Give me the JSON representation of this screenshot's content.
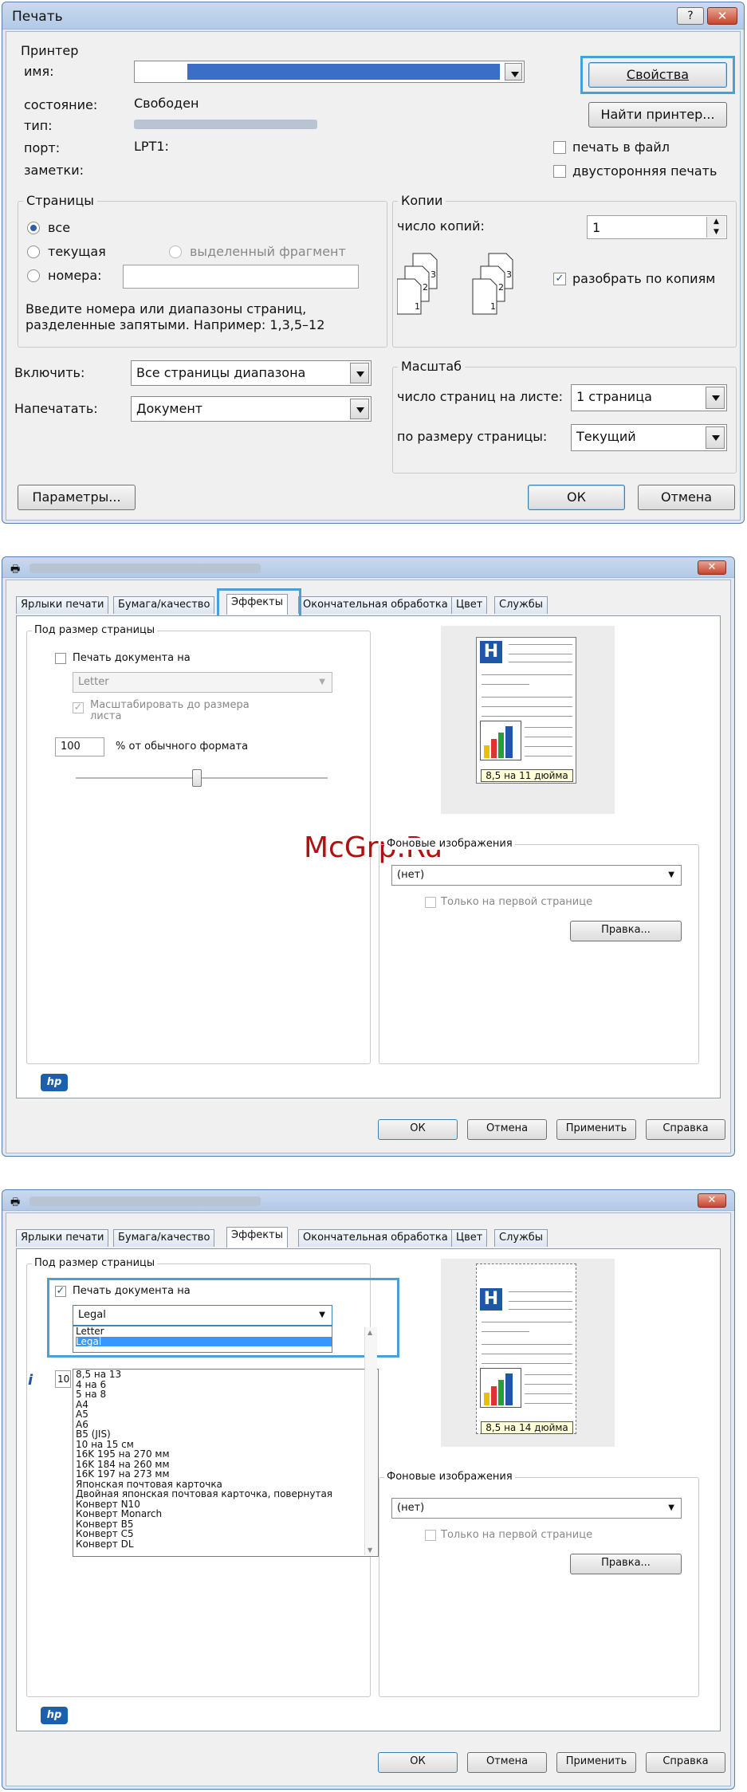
{
  "print_dialog": {
    "title": "Печать",
    "help_btn": "?",
    "printer_group": "Принтер",
    "name_label": "имя:",
    "status_label": "состояние:",
    "status_value": "Свободен",
    "type_label": "тип:",
    "port_label": "порт:",
    "port_value": "LPT1:",
    "comments_label": "заметки:",
    "properties_btn": "Свойства",
    "find_printer_btn": "Найти принтер...",
    "print_to_file": "печать в файл",
    "duplex": "двусторонняя печать",
    "pages_group": "Страницы",
    "all": "все",
    "current": "текущая",
    "selection": "выделенный фрагмент",
    "numbers": "номера:",
    "hint_line1": "Введите номера или диапазоны страниц,",
    "hint_line2": "разделенные запятыми. Например: 1,3,5–12",
    "copies_group": "Копии",
    "copies_label": "число копий:",
    "copies_value": "1",
    "collate": "разобрать по копиям",
    "include_label": "Включить:",
    "include_value": "Все страницы диапазона",
    "print_label": "Напечатать:",
    "print_value": "Документ",
    "scale_group": "Масштаб",
    "pages_per_sheet_label": "число страниц на листе:",
    "pages_per_sheet_value": "1 страница",
    "fit_label": "по размеру страницы:",
    "fit_value": "Текущий",
    "options_btn": "Параметры...",
    "ok_btn": "ОК",
    "cancel_btn": "Отмена"
  },
  "props1": {
    "tabs": [
      "Ярлыки печати",
      "Бумага/качество",
      "Эффекты",
      "Окончательная обработка",
      "Цвет",
      "Службы"
    ],
    "resize_group": "Под размер страницы",
    "print_doc_on": "Печать документа на",
    "paper_value": "Letter",
    "scale_to_fit_1": "Масштабировать до размера",
    "scale_to_fit_2": "листа",
    "percent_value": "100",
    "percent_label": "% от обычного формата",
    "preview_label": "8,5 на 11 дюйма",
    "watermarks_group": "Фоновые изображения",
    "watermark_value": "(нет)",
    "first_page_only": "Только на первой странице",
    "edit_btn": "Правка...",
    "ok_btn": "ОК",
    "cancel_btn": "Отмена",
    "apply_btn": "Применить",
    "help_btn": "Справка",
    "hp_logo": "hp"
  },
  "watermark_text": "McGrp.Ru",
  "props2": {
    "tabs": [
      "Ярлыки печати",
      "Бумага/качество",
      "Эффекты",
      "Окончательная обработка",
      "Цвет",
      "Службы"
    ],
    "resize_group": "Под размер страницы",
    "print_doc_on": "Печать документа на",
    "paper_value": "Legal",
    "top_list": [
      "Letter",
      "Legal"
    ],
    "list_items": [
      "8,5 на 13",
      "4 на 6",
      "5 на 8",
      "A4",
      "A5",
      "A6",
      "B5 (JIS)",
      "10 на 15 см",
      "16K 195 на 270 мм",
      "16K 184 на 260 мм",
      "16K 197 на 273 мм",
      "Японская почтовая карточка",
      "Двойная японская почтовая карточка, повернутая",
      "Конверт N10",
      "Конверт Monarch",
      "Конверт B5",
      "Конверт C5",
      "Конверт DL"
    ],
    "percent_partial": "10",
    "preview_label": "8,5 на 14 дюйма",
    "watermarks_group": "Фоновые изображения",
    "watermark_value": "(нет)",
    "first_page_only": "Только на первой странице",
    "edit_btn": "Правка...",
    "ok_btn": "ОК",
    "cancel_btn": "Отмена",
    "apply_btn": "Применить",
    "help_btn": "Справка",
    "hp_logo": "hp"
  }
}
